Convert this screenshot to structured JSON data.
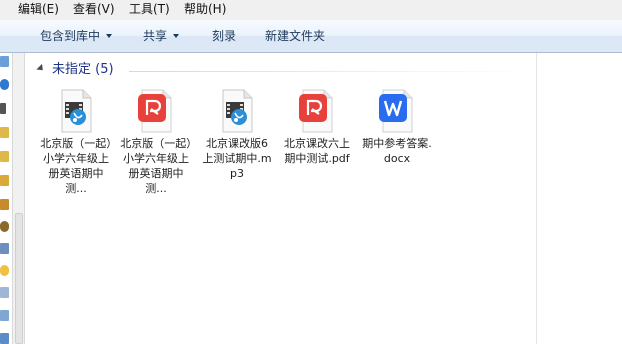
{
  "menu": [
    "编辑(E)",
    "查看(V)",
    "工具(T)",
    "帮助(H)"
  ],
  "toolbar": {
    "include_library": "包含到库中",
    "share": "共享",
    "burn": "刻录",
    "new_folder": "新建文件夹"
  },
  "group": {
    "title": "未指定 (5)"
  },
  "files": [
    {
      "name": "北京版（一起）小学六年级上册英语期中测...",
      "type": "mp4-video",
      "icon": "video-file-icon"
    },
    {
      "name": "北京版（一起）小学六年级上册英语期中测...",
      "type": "pdf",
      "icon": "pdf-file-icon"
    },
    {
      "name": "北京课改版6上测试期中.mp3",
      "type": "mp3-audio",
      "icon": "audio-file-icon"
    },
    {
      "name": "北京课改六上 期中测试.pdf",
      "type": "pdf",
      "icon": "pdf-file-icon"
    },
    {
      "name": "期中参考答案.docx",
      "type": "docx",
      "icon": "word-file-icon"
    }
  ],
  "colors": {
    "pdf_red": "#e8413c",
    "word_blue": "#2a6cf0",
    "media_blue": "#2a8fd8",
    "header_blue": "#1e3287"
  }
}
